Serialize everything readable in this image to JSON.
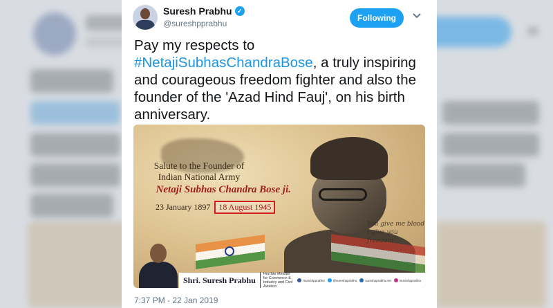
{
  "tweet": {
    "display_name": "Suresh Prabhu",
    "verified_glyph": "✓",
    "handle": "@sureshpprabhu",
    "follow_label": "Following",
    "text_before": "Pay my respects to ",
    "hashtag": "#NetajiSubhasChandraBose",
    "text_after": ", a truly inspiring and  courageous freedom fighter and also the founder of the  'Azad Hind Fauj', on his birth anniversary.",
    "timestamp": "7:37 PM - 22 Jan 2019",
    "icons": {
      "verified": "verified-badge-icon",
      "menu": "chevron-down-icon"
    }
  },
  "media": {
    "salute_line1": "Salute to the Founder of",
    "salute_line2": "Indian National Army",
    "honoree": "Netaji Subhas Chandra Bose ji.",
    "birth_date": "23 January 1897",
    "death_date": "18 August 1945",
    "script_line1": "You give me blood",
    "script_line2": "I give you freedom",
    "signature": "Shri. Suresh Prabhu",
    "role": "Hon'ble Minister for Commerce & Industry and Civil Aviation",
    "socials": [
      {
        "icon": "facebook-icon",
        "color": "#3b5998",
        "label": "/sureshpprabhu"
      },
      {
        "icon": "twitter-icon",
        "color": "#1da1f2",
        "label": "@sureshpprabhu"
      },
      {
        "icon": "web-icon",
        "color": "#2b6cb0",
        "label": "sureshpprabhu.net"
      },
      {
        "icon": "instagram-icon",
        "color": "#c13584",
        "label": "/sureshpprabhu"
      }
    ]
  },
  "colors": {
    "accent": "#1da1f2",
    "hashtag": "#1b95e0",
    "honoree": "#9b1c1c"
  }
}
